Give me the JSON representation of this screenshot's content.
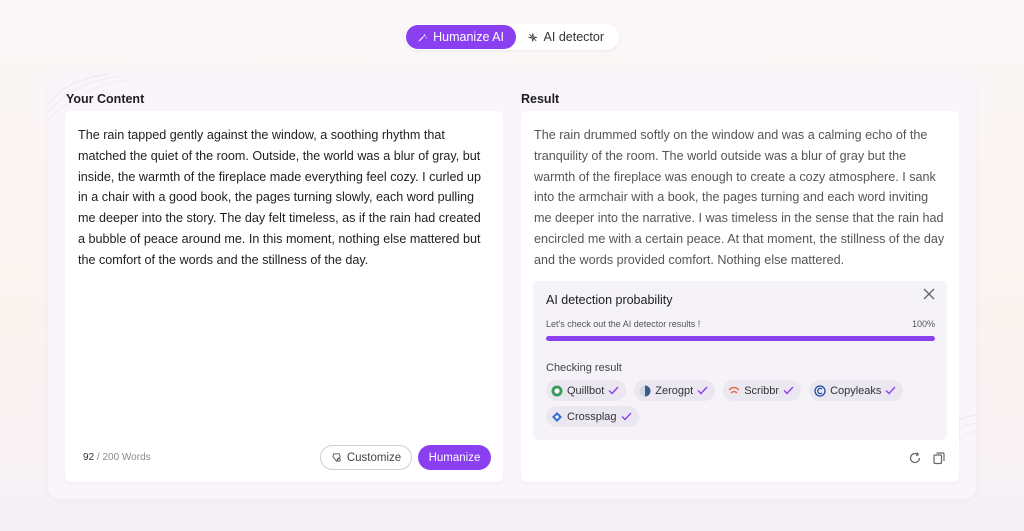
{
  "toggle": {
    "humanize_label": "Humanize AI",
    "detector_label": "AI detector"
  },
  "left": {
    "title": "Your Content",
    "text": "The rain tapped gently against the window, a soothing rhythm that matched the quiet of the room. Outside, the world was a blur of gray, but inside, the warmth of the fireplace made everything feel cozy. I curled up in a chair with a good book, the pages turning slowly, each word pulling me deeper into the story. The day felt timeless, as if the rain had created a bubble of peace around me. In this moment, nothing else mattered but the comfort of the words and the stillness of the day.",
    "word_count_current": "92",
    "word_count_rest": " / 200 Words",
    "customize_label": "Customize",
    "humanize_label": "Humanize"
  },
  "right": {
    "title": "Result",
    "text": "The rain drummed softly on the window and was a calming echo of the tranquility of the room. The world outside was a blur of gray but the warmth of the fireplace was enough to create a cozy atmosphere. I sank into the armchair with a book, the pages turning and each word inviting me deeper into the narrative. I was timeless in the sense that the rain had encircled me with a certain peace. At that moment, the stillness of the day and the words provided comfort. Nothing else mattered.",
    "detection": {
      "title": "AI detection probability",
      "subtitle": "Let's check out the AI detector results !",
      "percent_label": "100%",
      "progress": 1.0,
      "checking_label": "Checking result",
      "detectors_row1": [
        "Quillbot",
        "Zerogpt",
        "Scribbr",
        "Copyleaks"
      ],
      "detectors_row2": [
        "Crossplag"
      ]
    }
  },
  "colors": {
    "accent": "#8a3ff0",
    "check": "#8a3ff0"
  },
  "icons": {
    "humanize": "magic-wand-icon",
    "detector": "sparkle-icon",
    "customize": "sliders-icon",
    "close": "close-icon",
    "regenerate": "refresh-icon",
    "copy": "copy-icon"
  }
}
